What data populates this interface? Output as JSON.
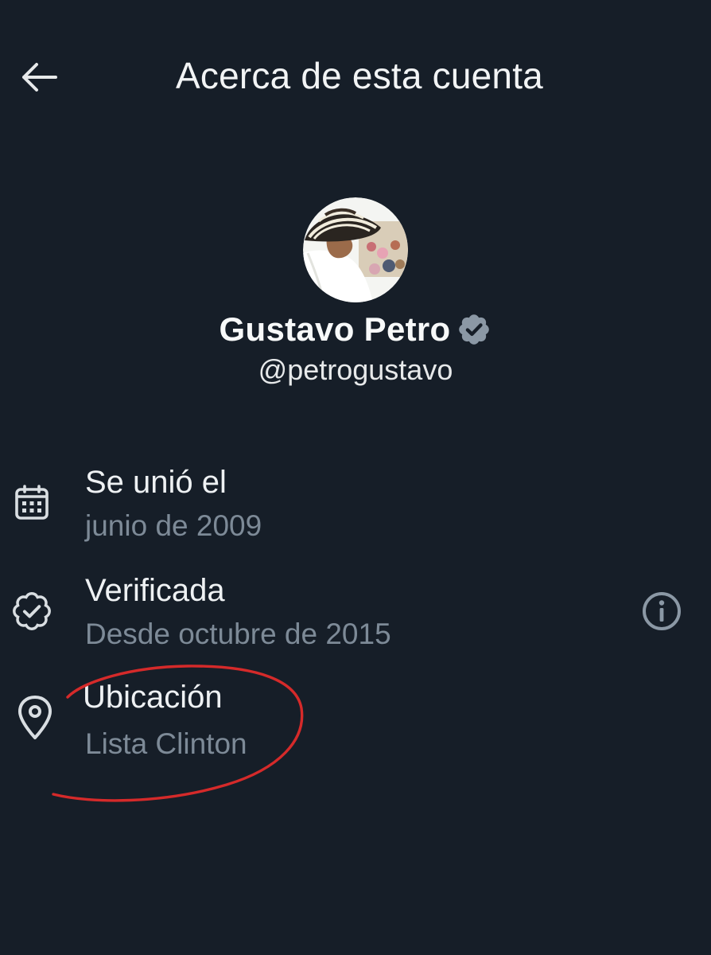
{
  "header": {
    "title": "Acerca de esta cuenta",
    "back_icon": "arrow-left-icon"
  },
  "profile": {
    "avatar_icon": "profile-photo",
    "display_name": "Gustavo Petro",
    "verified_icon": "verified-badge-icon",
    "handle": "@petrogustavo"
  },
  "info": {
    "joined": {
      "icon": "calendar-icon",
      "label": "Se unió el",
      "value": "junio de 2009"
    },
    "verified": {
      "icon": "verified-outline-icon",
      "label": "Verificada",
      "value": "Desde octubre de 2015",
      "action_icon": "info-icon"
    },
    "location": {
      "icon": "location-pin-icon",
      "label": "Ubicación",
      "value": "Lista Clinton"
    }
  },
  "colors": {
    "background": "#161e28",
    "primary_text": "#e7e9ea",
    "secondary_text": "#7d8a97",
    "icon": "#d9dee2",
    "verified_badge": "#8b98a5",
    "annotation": "#d52a2a"
  }
}
